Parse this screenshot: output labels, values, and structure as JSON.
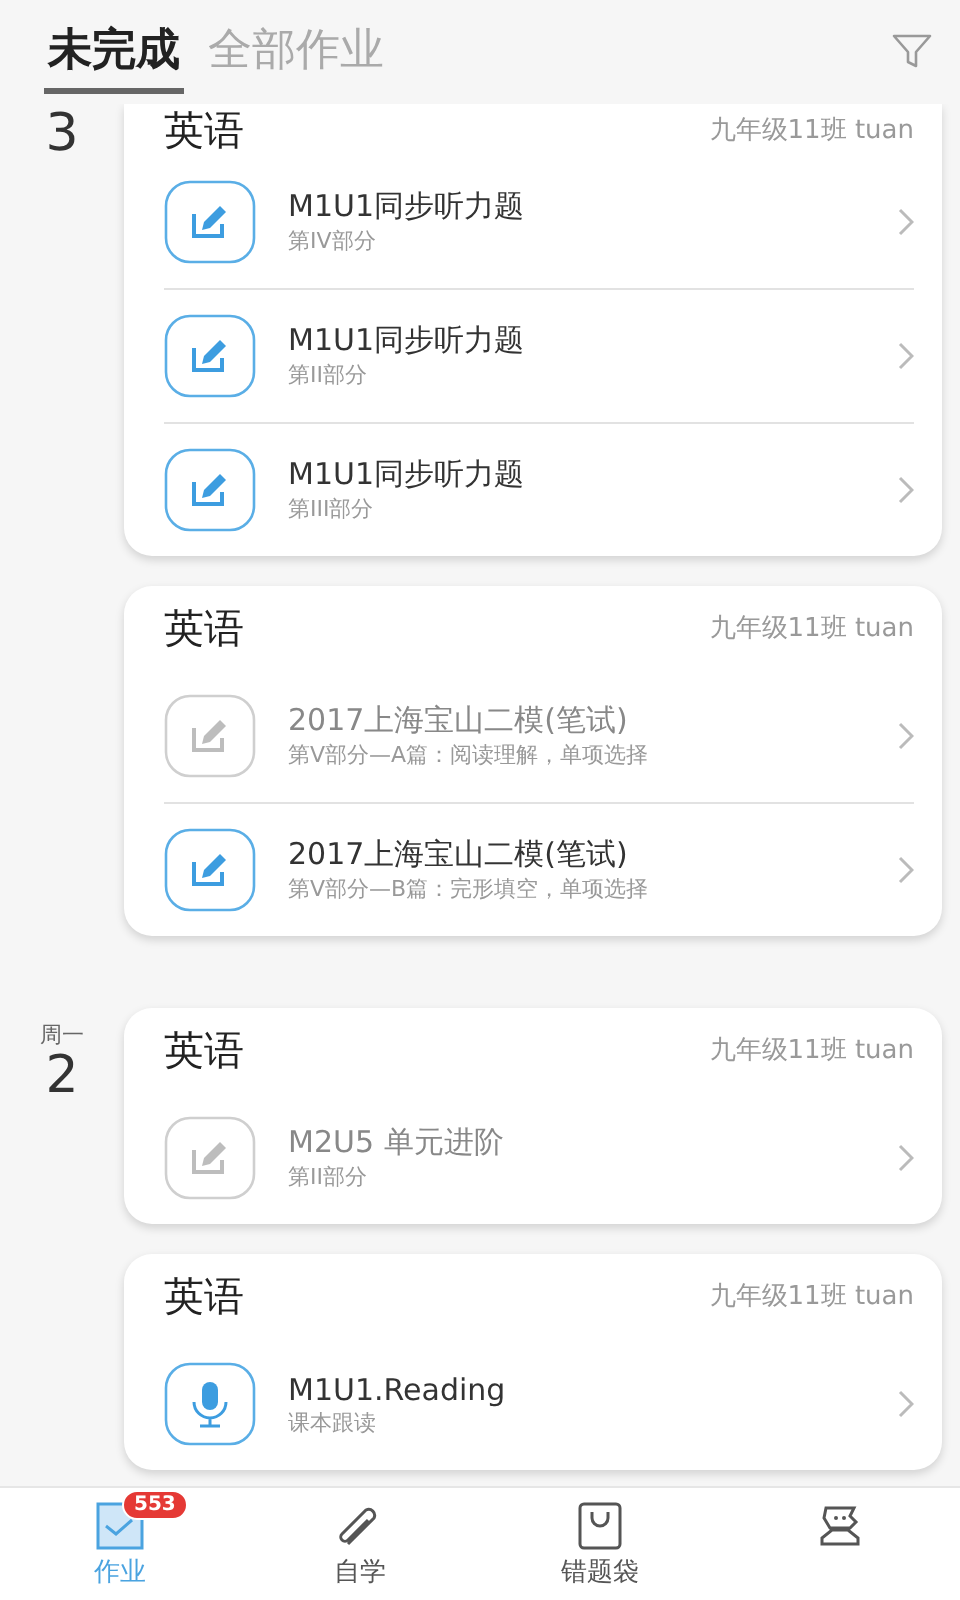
{
  "tabs": [
    {
      "label": "未完成",
      "selected": true
    },
    {
      "label": "全部作业",
      "selected": false
    }
  ],
  "groups": [
    {
      "day": "3",
      "cards": [
        {
          "subject": "英语",
          "class_info": "九年级11班 tuan",
          "items": [
            {
              "kind": "edit",
              "title": "M1U1同步听力题",
              "subtitle": "第IV部分",
              "disabled": false
            },
            {
              "kind": "edit",
              "title": "M1U1同步听力题",
              "subtitle": "第II部分",
              "disabled": false
            },
            {
              "kind": "edit",
              "title": "M1U1同步听力题",
              "subtitle": "第III部分",
              "disabled": false
            }
          ]
        },
        {
          "subject": "英语",
          "class_info": "九年级11班 tuan",
          "items": [
            {
              "kind": "edit",
              "title": "2017上海宝山二模(笔试)",
              "subtitle": "第V部分—A篇：阅读理解，单项选择",
              "disabled": true
            },
            {
              "kind": "edit",
              "title": "2017上海宝山二模(笔试)",
              "subtitle": "第V部分—B篇：完形填空，单项选择",
              "disabled": false
            }
          ]
        }
      ]
    },
    {
      "weekday": "周一",
      "day": "2",
      "cards": [
        {
          "subject": "英语",
          "class_info": "九年级11班 tuan",
          "items": [
            {
              "kind": "edit",
              "title": "M2U5 单元进阶",
              "subtitle": "第II部分",
              "disabled": true
            }
          ]
        },
        {
          "subject": "英语",
          "class_info": "九年级11班 tuan",
          "items": [
            {
              "kind": "mic",
              "title": "M1U1.Reading",
              "subtitle": "课本跟读",
              "disabled": false
            }
          ]
        }
      ]
    }
  ],
  "nav": [
    {
      "kind": "homework",
      "label": "作业",
      "badge": "553",
      "selected": true
    },
    {
      "kind": "study",
      "label": "自学",
      "selected": false
    },
    {
      "kind": "bag",
      "label": "错题袋",
      "selected": false
    },
    {
      "kind": "me",
      "selected": false
    }
  ]
}
